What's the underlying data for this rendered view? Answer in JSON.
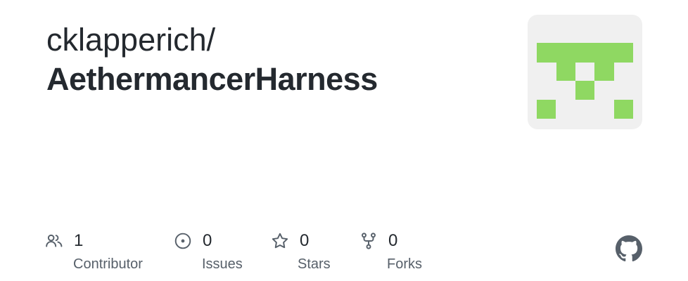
{
  "repo_card": {
    "owner": "cklapperich/",
    "name": "AethermancerHarness"
  },
  "avatar": {
    "icon": "identicon",
    "color": "#8fd862",
    "background": "#f0f0f0"
  },
  "stats": {
    "contributors": {
      "icon": "people-icon",
      "count": "1",
      "label": "Contributor"
    },
    "issues": {
      "icon": "issue-opened-icon",
      "count": "0",
      "label": "Issues"
    },
    "stars": {
      "icon": "star-icon",
      "count": "0",
      "label": "Stars"
    },
    "forks": {
      "icon": "repo-forked-icon",
      "count": "0",
      "label": "Forks"
    }
  },
  "footer": {
    "logo_icon": "github-mark-icon",
    "logo_color": "#57606a"
  }
}
